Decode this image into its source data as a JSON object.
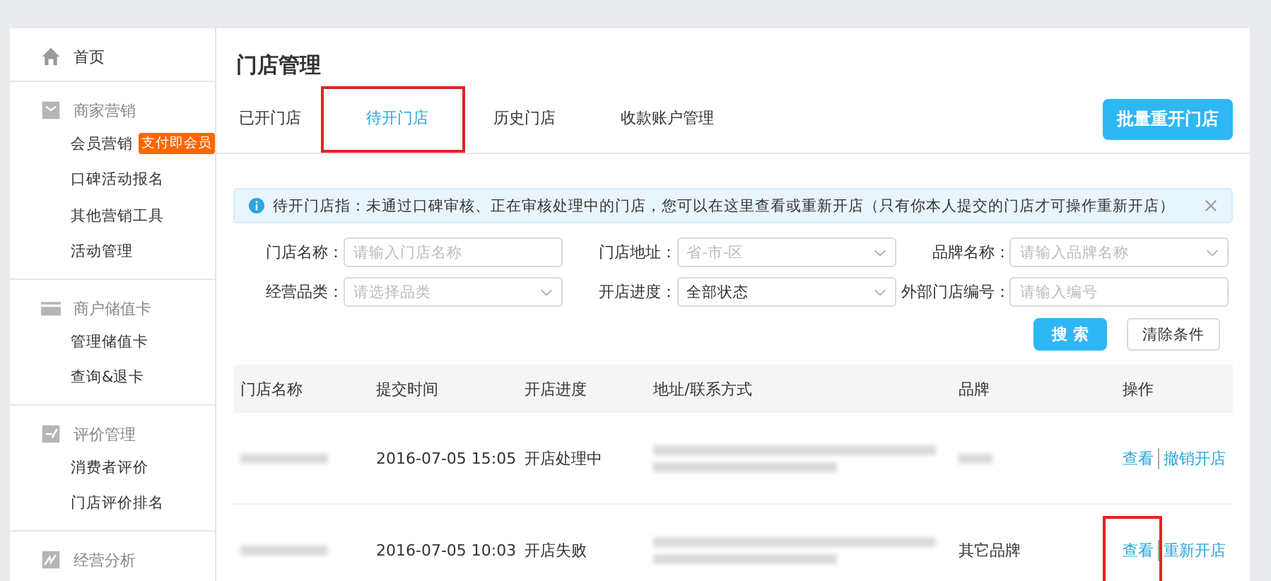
{
  "sidebar": {
    "groups": [
      {
        "title": "首页"
      },
      {
        "title": "商家营销",
        "items": [
          {
            "label": "会员营销",
            "badge": "支付即会员"
          },
          {
            "label": "口碑活动报名"
          },
          {
            "label": "其他营销工具"
          },
          {
            "label": "活动管理"
          }
        ]
      },
      {
        "title": "商户储值卡",
        "items": [
          {
            "label": "管理储值卡"
          },
          {
            "label": "查询&退卡"
          }
        ]
      },
      {
        "title": "评价管理",
        "items": [
          {
            "label": "消费者评价"
          },
          {
            "label": "门店评价排名"
          }
        ]
      },
      {
        "title": "经营分析"
      }
    ]
  },
  "page_title": "门店管理",
  "tabs": [
    {
      "label": "已开门店",
      "selected": false,
      "highlighted": false
    },
    {
      "label": "待开门店",
      "selected": true,
      "highlighted": true
    },
    {
      "label": "历史门店",
      "selected": false,
      "highlighted": false
    },
    {
      "label": "收款账户管理",
      "selected": false,
      "highlighted": false
    }
  ],
  "batch_button": "批量重开门店",
  "notice": {
    "text": "待开门店指：未通过口碑审核、正在审核处理中的门店，您可以在这里查看或重新开店（只有你本人提交的门店才可操作重新开店）"
  },
  "filters": [
    {
      "label": "门店名称：",
      "kind": "input",
      "placeholder": "请输入门店名称"
    },
    {
      "label": "门店地址：",
      "kind": "select",
      "placeholder": "省-市-区"
    },
    {
      "label": "品牌名称：",
      "kind": "select",
      "placeholder": "请输入品牌名称"
    },
    {
      "label": "经营品类：",
      "kind": "select",
      "placeholder": "请选择品类"
    },
    {
      "label": "开店进度：",
      "kind": "select",
      "value": "全部状态"
    },
    {
      "label": "外部门店编号：",
      "kind": "input",
      "placeholder": "请输入编号"
    }
  ],
  "search_button": "搜 索",
  "clear_button": "清除条件",
  "table": {
    "columns": [
      "门店名称",
      "提交时间",
      "开店进度",
      "地址/联系方式",
      "品牌",
      "操作"
    ],
    "rows": [
      {
        "time": "2016-07-05 15:05",
        "status": "开店处理中",
        "brand": null,
        "actions": [
          {
            "label": "查看",
            "highlighted": false
          },
          {
            "label": "撤销开店",
            "highlighted": false
          }
        ]
      },
      {
        "time": "2016-07-05 10:03",
        "status": "开店失败",
        "brand": "其它品牌",
        "actions": [
          {
            "label": "查看",
            "highlighted": true
          },
          {
            "label": "重新开店",
            "highlighted": false
          }
        ]
      }
    ]
  }
}
